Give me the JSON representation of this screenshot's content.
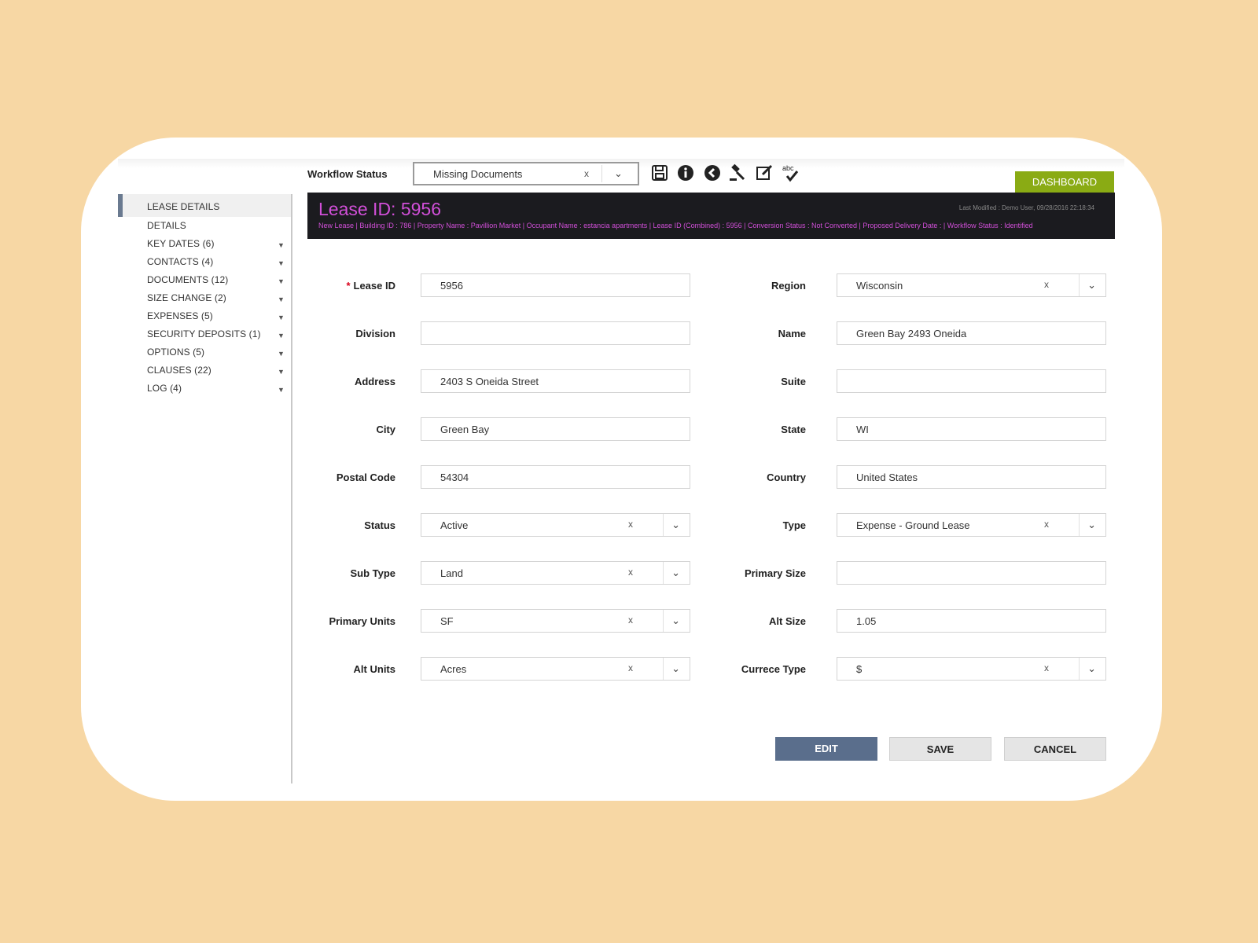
{
  "toolbar": {
    "workflow_label": "Workflow Status",
    "workflow_value": "Missing Documents",
    "clear_glyph": "x",
    "icons": [
      "save-icon",
      "info-icon",
      "back-icon",
      "gavel-icon",
      "edit-icon",
      "spellcheck-icon"
    ],
    "spellcheck_text": "abc",
    "dashboard_label": "DASHBOARD"
  },
  "colors": {
    "accent_purple": "#d14fd8",
    "dashboard_green": "#8aab14",
    "edit_blue": "#5a6e8c",
    "header_dark": "#1b1b1f"
  },
  "sidebar": {
    "items": [
      {
        "label": "LEASE DETAILS",
        "caret": false
      },
      {
        "label": "DETAILS",
        "caret": false
      },
      {
        "label": "KEY DATES (6)",
        "caret": true
      },
      {
        "label": "CONTACTS (4)",
        "caret": true
      },
      {
        "label": "DOCUMENTS (12)",
        "caret": true
      },
      {
        "label": "SIZE CHANGE (2)",
        "caret": true
      },
      {
        "label": "EXPENSES (5)",
        "caret": true
      },
      {
        "label": "SECURITY DEPOSITS (1)",
        "caret": true
      },
      {
        "label": "OPTIONS (5)",
        "caret": true
      },
      {
        "label": "CLAUSES (22)",
        "caret": true
      },
      {
        "label": "LOG (4)",
        "caret": true
      }
    ]
  },
  "header": {
    "title": "Lease ID: 5956",
    "last_modified": "Last Modified : Demo User, 09/28/2016 22:18:34",
    "meta": "New Lease | Building ID : 786 | Property Name : Pavillion Market | Occupant Name : estancia apartments | Lease ID (Combined) : 5956 | Conversion Status : Not Converted | Proposed Delivery Date : | Workflow Status : Identified"
  },
  "form": {
    "left": [
      {
        "label": "Lease ID",
        "value": "5956",
        "required": true,
        "select": false
      },
      {
        "label": "Division",
        "value": "",
        "select": false
      },
      {
        "label": "Address",
        "value": "2403 S Oneida Street",
        "select": false
      },
      {
        "label": "City",
        "value": "Green Bay",
        "select": false
      },
      {
        "label": "Postal Code",
        "value": "54304",
        "select": false
      },
      {
        "label": "Status",
        "value": "Active",
        "select": true
      },
      {
        "label": "Sub Type",
        "value": "Land",
        "select": true
      },
      {
        "label": "Primary Units",
        "value": "SF",
        "select": true
      },
      {
        "label": "Alt Units",
        "value": "Acres",
        "select": true
      }
    ],
    "right": [
      {
        "label": "Region",
        "value": "Wisconsin",
        "select": true
      },
      {
        "label": "Name",
        "value": "Green Bay 2493 Oneida",
        "select": false
      },
      {
        "label": "Suite",
        "value": "",
        "select": false
      },
      {
        "label": "State",
        "value": "WI",
        "select": false
      },
      {
        "label": "Country",
        "value": "United States",
        "select": false
      },
      {
        "label": "Type",
        "value": "Expense - Ground Lease",
        "select": true
      },
      {
        "label": "Primary Size",
        "value": "",
        "select": false
      },
      {
        "label": "Alt Size",
        "value": "1.05",
        "select": false
      },
      {
        "label": "Currece Type",
        "value": "$",
        "select": true
      }
    ]
  },
  "actions": {
    "edit": "EDIT",
    "save": "SAVE",
    "cancel": "CANCEL"
  }
}
